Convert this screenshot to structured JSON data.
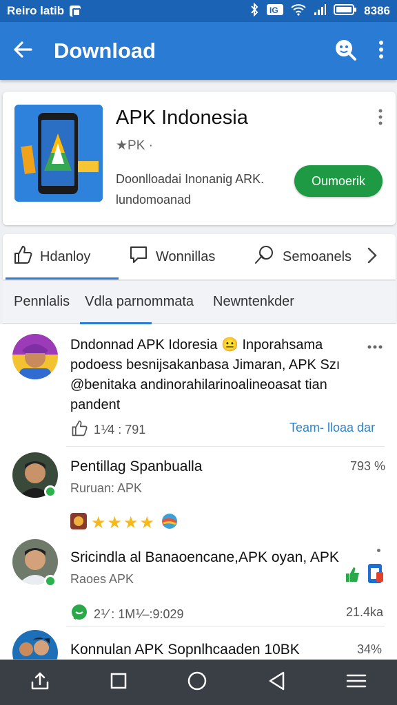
{
  "status_bar": {
    "carrier": "Reiro latib",
    "time": "8386"
  },
  "app_bar": {
    "title": "Download",
    "icons": [
      "back-arrow-icon",
      "search-face-icon",
      "more-vert-icon"
    ]
  },
  "app_card": {
    "name": "APK Indonesia",
    "subtitle": "★PK ·",
    "description": "Doonlloadai Inonanig ARK. lundomoanad",
    "install_label": "Oumoerik"
  },
  "actions": [
    {
      "label": "Hdanloy",
      "icon": "thumbs-up-icon"
    },
    {
      "label": "Wonnillas",
      "icon": "comment-icon"
    },
    {
      "label": "Semoanels",
      "icon": "share-icon"
    }
  ],
  "tabs": [
    "Pennlalis",
    "Vdla parnommata",
    "Newntenkder"
  ],
  "posts": [
    {
      "title": "Dndonnad APK Idoresia 😐 Inporahsama",
      "body": "podoess besnijsakanbasa Jimaran, APK Szı @benitaka andinorahilarinoalineoasat tian pandent",
      "likes": "1⅟4 : 791",
      "link": "Team- lloaa dar"
    },
    {
      "title": "Pentillag Spanbualla",
      "sub": "Ruruan: APK",
      "percent": "793 %",
      "rating": 4
    },
    {
      "title": "Sricindla al Banaoencane,APK oyan, APK",
      "sub": "Raoes APK",
      "meta": "2⅟ : 1M⅟–:9:029",
      "count": "21.4ka"
    },
    {
      "title": "Konnulan APK Sopnlhcaaden 10BK",
      "percent": "34%"
    }
  ],
  "colors": {
    "primary": "#2a7bd4",
    "status": "#1b63b5",
    "install": "#1e9a45",
    "link": "#2a82c9"
  }
}
